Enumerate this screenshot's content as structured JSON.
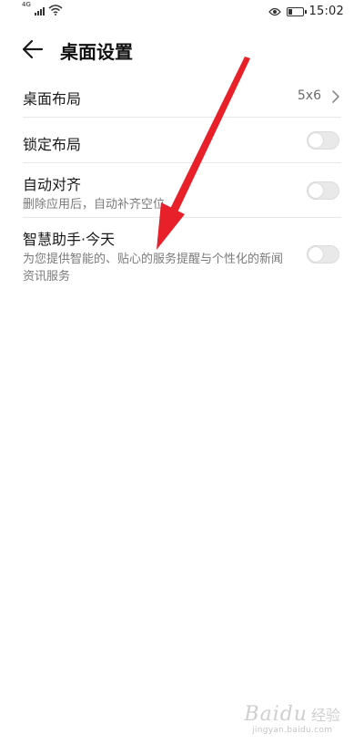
{
  "status_bar": {
    "network": "4G",
    "time": "15:02",
    "battery_level": 0.3,
    "icons": [
      "signal-icon",
      "wifi-icon",
      "eye-icon",
      "battery-icon"
    ]
  },
  "header": {
    "title": "桌面设置",
    "back_icon": "back-arrow-icon"
  },
  "settings": {
    "layout": {
      "label": "桌面布局",
      "value": "5x6"
    },
    "lock_layout": {
      "label": "锁定布局",
      "enabled": false
    },
    "auto_align": {
      "label": "自动对齐",
      "description": "删除应用后，自动补齐空位",
      "enabled": false
    },
    "assistant_today": {
      "label": "智慧助手·今天",
      "description": "为您提供智能的、贴心的服务提醒与个性化的新闻资讯服务",
      "enabled": false
    }
  },
  "annotation": {
    "color": "#e8202a"
  },
  "watermark": {
    "brand": "Baidu",
    "brand_cn": "经验",
    "url": "jingyan.baidu.com"
  },
  "colors": {
    "toggle_off": "#e9e9e9",
    "divider": "#e8e8e8",
    "secondary_text": "#7a7a7a"
  }
}
